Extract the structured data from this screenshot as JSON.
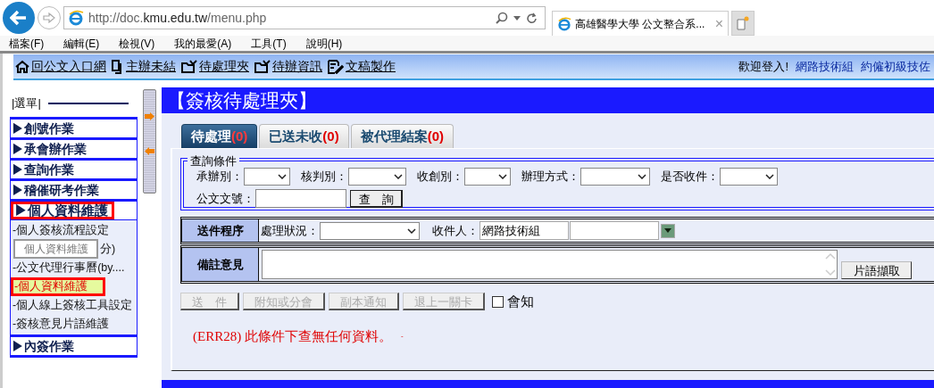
{
  "browser": {
    "url": "http://doc.**kmu.edu.tw**/menu.php",
    "tab_title": "高雄醫學大學 公文整合系...",
    "tab_close": "×",
    "menu": [
      "檔案(F)",
      "編輯(E)",
      "檢視(V)",
      "我的最愛(A)",
      "工具(T)",
      "說明(H)"
    ]
  },
  "toolbar": {
    "links": [
      {
        "label": "回公文入口網"
      },
      {
        "label": "主辦未結"
      },
      {
        "label": "待處理夾"
      },
      {
        "label": "待辦資訊"
      },
      {
        "label": "文稿製作"
      }
    ],
    "welcome": "歡迎登入!",
    "user_links": [
      "網路技術組",
      "約僱初級技佐"
    ]
  },
  "sidebar": {
    "heading": "|選單|",
    "tooltip": "個人資料維護",
    "sections": [
      {
        "marker": "▶",
        "label": "創號作業",
        "expanded": false,
        "highlighted": false
      },
      {
        "marker": "▶",
        "label": "承會辦作業",
        "expanded": false,
        "highlighted": false
      },
      {
        "marker": "▶",
        "label": "查詢作業",
        "expanded": false,
        "highlighted": false
      },
      {
        "marker": "▶",
        "label": "稽催研考作業",
        "expanded": false,
        "highlighted": false
      },
      {
        "marker": "▶",
        "label": "個人資料維護",
        "expanded": true,
        "highlighted": true,
        "children": [
          {
            "label": "-個人簽核流程設定",
            "selected": false,
            "highlighted": false
          },
          {
            "label": "分)",
            "selected": false,
            "highlighted": false
          },
          {
            "label": "-公文代理行事曆(by....",
            "selected": false,
            "highlighted": false
          },
          {
            "label": "-個人資料維護",
            "selected": true,
            "highlighted": true
          },
          {
            "label": "-個人線上簽核工具設定",
            "selected": false,
            "highlighted": false
          },
          {
            "label": "-簽核意見片語維護",
            "selected": false,
            "highlighted": false
          }
        ]
      },
      {
        "marker": "▶",
        "label": "內簽作業",
        "expanded": false,
        "highlighted": false
      }
    ]
  },
  "main": {
    "title": "【簽核待處理夾】",
    "tabs": [
      {
        "label": "待處理",
        "count": "(0)",
        "selected": true
      },
      {
        "label": "已送未收",
        "count": "(0)",
        "selected": false
      },
      {
        "label": "被代理結案",
        "count": "(0)",
        "selected": false
      }
    ],
    "query": {
      "legend": "查詢條件",
      "fields": [
        {
          "label": "承辦別：",
          "kind": "select"
        },
        {
          "label": "核判別：",
          "kind": "select"
        },
        {
          "label": "收創別：",
          "kind": "select"
        },
        {
          "label": "辦理方式：",
          "kind": "select"
        },
        {
          "label": "是否收件：",
          "kind": "select"
        },
        {
          "label": "公文文號：",
          "kind": "text"
        }
      ],
      "button": "查　詢"
    },
    "send": {
      "header": "送件程序",
      "status_label": "處理狀況：",
      "recipient_label": "收件人：",
      "recipient_value": "網路技術組"
    },
    "remarks": {
      "header": "備註意見",
      "button": "片語擷取"
    },
    "actions": [
      {
        "label": "送　件",
        "disabled": true
      },
      {
        "label": "附知或分會",
        "disabled": true
      },
      {
        "label": "副本通知",
        "disabled": true
      },
      {
        "label": "退上一關卡",
        "disabled": true
      }
    ],
    "notify": {
      "label": "會知",
      "checked": false
    },
    "error": "(ERR28) 此條件下查無任何資料。",
    "error_trail": "-"
  }
}
